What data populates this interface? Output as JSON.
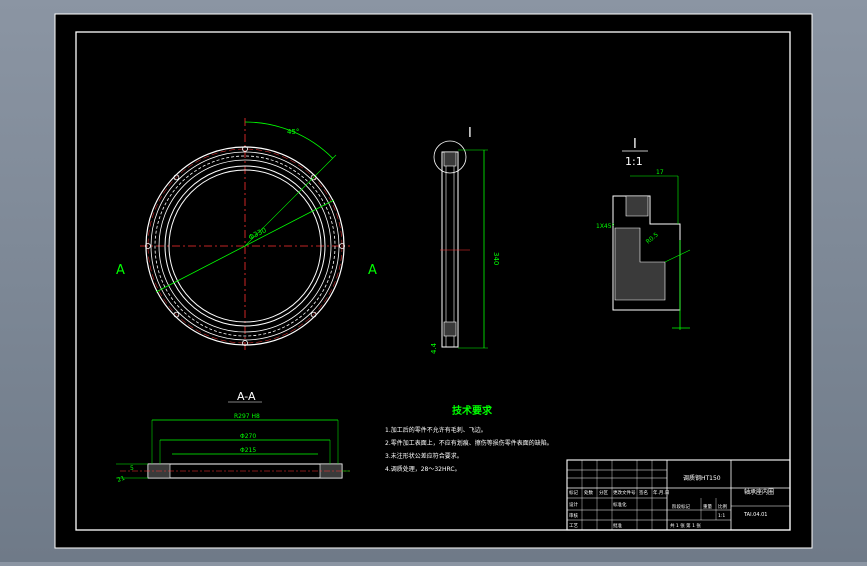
{
  "drawing": {
    "section_label_left": "A",
    "section_label_right": "A",
    "detail_marker": "I",
    "detail_title": "I",
    "detail_scale": "1:1",
    "section_title": "A-A",
    "dim_angle": "45°",
    "dim_diameter": "Φ330",
    "dim_height": "340",
    "dim_thickness": "4.4",
    "dim_detail_top": "17",
    "dim_detail_left": "1X45°",
    "dim_detail_chamfer": "R0.5",
    "dim_section_outer": "R297 H8",
    "dim_section_mid": "Φ270",
    "dim_section_inner": "Φ215",
    "dim_section_side": "21",
    "dim_section_side2": "5"
  },
  "notes": {
    "title": "技术要求",
    "items": [
      "1.加工后的零件不允许有毛刺、飞边。",
      "2.零件加工表面上，不应有划痕、擦伤等损伤零件表面的缺陷。",
      "3.未注形状公差应符合要求。",
      "4.调质处理，28～32HRC。"
    ]
  },
  "title_block": {
    "material": "调质钢HT150",
    "part_name": "轴承座内圈",
    "scale": "1:1",
    "sheet": "共 1 张 第 1 张",
    "code": "TAI.04.01",
    "labels": [
      "标记",
      "处数",
      "分区",
      "更改文件号",
      "签名",
      "年.月.日"
    ],
    "row2": [
      "设计",
      "",
      "",
      "标准化",
      "",
      ""
    ],
    "row3": [
      "审核",
      "",
      "",
      "",
      "",
      ""
    ],
    "row4": [
      "工艺",
      "",
      "",
      "批准",
      "",
      ""
    ],
    "stage_label": "阶段标记",
    "weight_label": "重量",
    "scale_label": "比例"
  }
}
